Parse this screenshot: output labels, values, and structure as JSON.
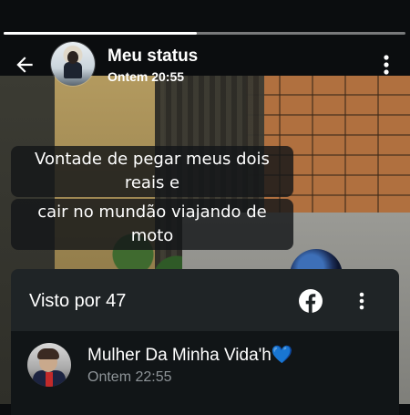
{
  "status_header": {
    "title": "Meu status",
    "time": "Ontem 20:55",
    "progress_fraction": 0.48
  },
  "caption": {
    "lines": [
      "Vontade de pegar meus dois reais e",
      "cair no mundão viajando de moto"
    ]
  },
  "viewers_sheet": {
    "title": "Visto por 47",
    "viewers": [
      {
        "name": "Mulher Da Minha Vida'h💙",
        "time": "Ontem 22:55"
      }
    ]
  },
  "icons": {
    "back": "arrow-left-icon",
    "menu": "more-vertical-icon",
    "facebook": "facebook-icon"
  },
  "colors": {
    "sheet_bg": "#1f2426",
    "row_bg": "#111517",
    "facebook_icon": "#ffffff",
    "secondary_text": "#8e9498"
  }
}
